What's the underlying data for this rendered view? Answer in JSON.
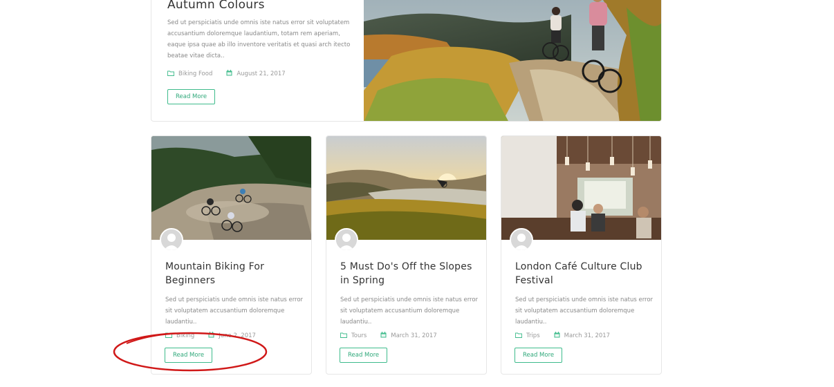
{
  "featured": {
    "title": "Autumn Colours",
    "excerpt": "Sed ut perspiciatis unde omnis iste natus error sit voluptatem accusantium doloremque laudantium, totam rem aperiam, eaque ipsa quae ab illo inventore veritatis et quasi arch itecto beatae vitae dicta..",
    "category": "Biking Food",
    "date": "August 21, 2017",
    "read_more": "Read More",
    "photo_icon": "cyclists-photo"
  },
  "cards": [
    {
      "title": "Mountain Biking For Beginners",
      "excerpt": "Sed ut perspiciatis unde omnis iste natus error sit voluptatem accusantium doloremque laudantiu..",
      "category": "Biking",
      "date": "June 2, 2017",
      "read_more": "Read More"
    },
    {
      "title": "5 Must Do's Off the Slopes in Spring",
      "excerpt": "Sed ut perspiciatis unde omnis iste natus error sit voluptatem accusantium doloremque laudantiu..",
      "category": "Tours",
      "date": "March 31, 2017",
      "read_more": "Read More"
    },
    {
      "title": "London Café Culture Club Festival",
      "excerpt": "Sed ut perspiciatis unde omnis iste natus error sit voluptatem accusantium doloremque laudantiu..",
      "category": "Trips",
      "date": "March 31, 2017",
      "read_more": "Read More"
    }
  ],
  "icons": {
    "category": "folder-icon",
    "date": "calendar-icon"
  },
  "colors": {
    "accent": "#3dbb8b",
    "annotation": "#d01818"
  }
}
